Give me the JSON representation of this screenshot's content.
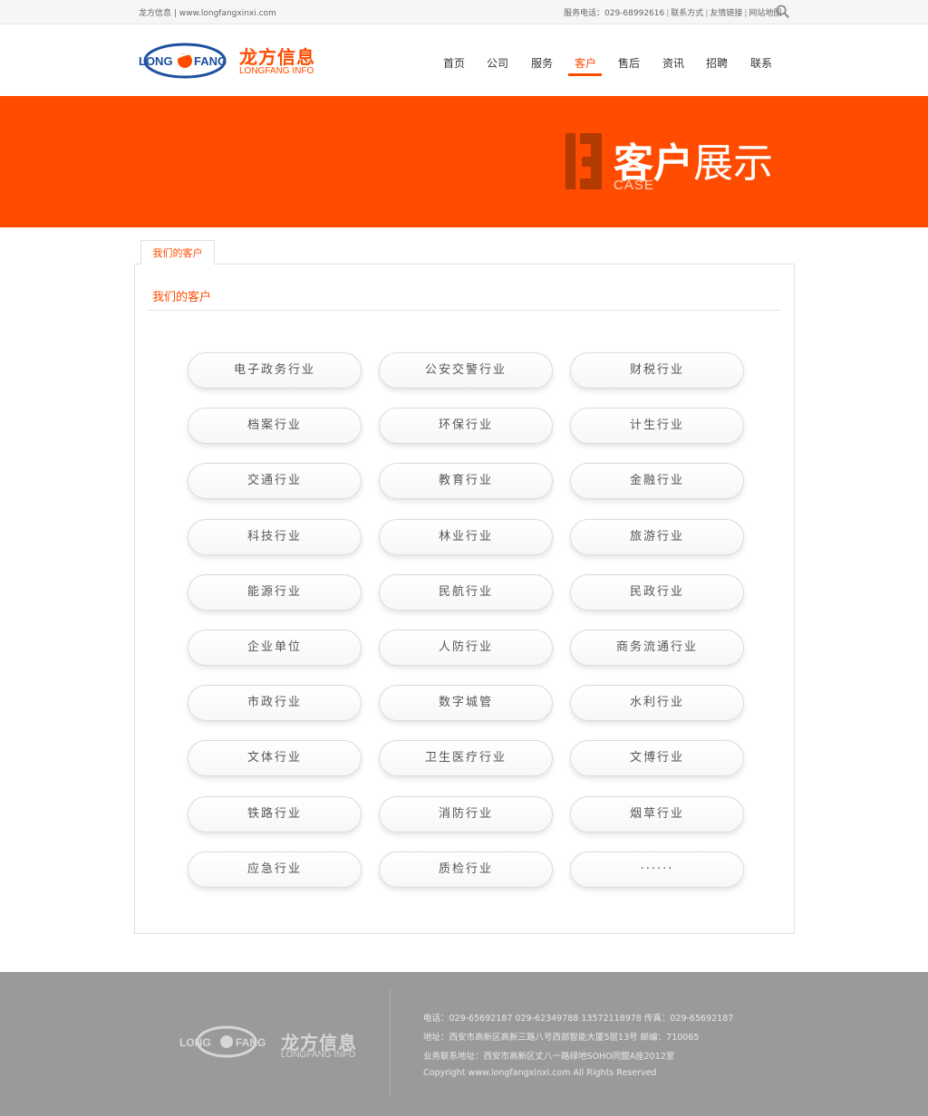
{
  "topbar": {
    "site": "龙方信息 | www.longfangxinxi.com",
    "phone": "服务电话：029-68992616",
    "links": [
      "联系方式",
      "友情链接",
      "网站地图"
    ]
  },
  "logo": {
    "en_left": "LONG",
    "en_right": "FANG",
    "cn": "龙方信息",
    "en": "LONGFANG INFO"
  },
  "nav": {
    "items": [
      "首页",
      "公司",
      "服务",
      "客户",
      "售后",
      "资讯",
      "招聘",
      "联系"
    ],
    "active_index": 3
  },
  "banner": {
    "number": "03",
    "title_bold": "客户",
    "title_light": "展示",
    "subtitle": "CASE"
  },
  "panel": {
    "tab": "我们的客户",
    "title": "我们的客户",
    "industries": [
      "电子政务行业",
      "公安交警行业",
      "财税行业",
      "档案行业",
      "环保行业",
      "计生行业",
      "交通行业",
      "教育行业",
      "金融行业",
      "科技行业",
      "林业行业",
      "旅游行业",
      "能源行业",
      "民航行业",
      "民政行业",
      "企业单位",
      "人防行业",
      "商务流通行业",
      "市政行业",
      "数字城管",
      "水利行业",
      "文体行业",
      "卫生医疗行业",
      "文博行业",
      "铁路行业",
      "消防行业",
      "烟草行业",
      "应急行业",
      "质检行业",
      "······"
    ]
  },
  "footer": {
    "logo_cn": "龙方信息",
    "logo_en": "LONGFANG INFO",
    "phone": "电话：029-65692187   029-62349788   13572118978   传真：029-65692187",
    "address": "地址：西安市高新区高新三路八号西部智能大厦5层13号    邮编：710065",
    "business_address": "业务联系地址：西安市高新区丈八一路绿地SOHO同盟A座2012室",
    "copyright": "Copyright  www.longfangxinxi.com  All Rights Reserved"
  },
  "colors": {
    "brand": "#ff4c00",
    "logo_blue": "#1d4fa0",
    "footer_bg": "#9a9a9a"
  },
  "icons": [
    "search-icon",
    "longfang-logo-icon",
    "number-03-icon"
  ]
}
